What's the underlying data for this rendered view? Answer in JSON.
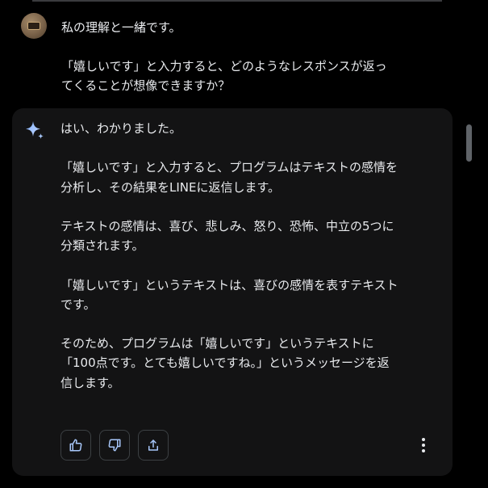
{
  "user_message": {
    "avatar_icon": "user-avatar-icon",
    "text": "私の理解と一緒です。\n\n「嬉しいです」と入力すると、どのようなレスポンスが返っ\nてくることが想像できますか？"
  },
  "assistant_message": {
    "icon": "sparkle-icon",
    "text": "はい、わかりました。\n\n「嬉しいです」と入力すると、プログラムはテキストの感情を\n分析し、その結果をLINEに返信します。\n\nテキストの感情は、喜び、悲しみ、怒り、恐怖、中立の5つに\n分類されます。\n\n「嬉しいです」というテキストは、喜びの感情を表すテキスト\nです。\n\nそのため、プログラムは「嬉しいです」というテキストに\n「100点です。とても嬉しいですね。」というメッセージを返\n信します。"
  },
  "actions": {
    "thumbs_up_icon": "thumbs-up-icon",
    "thumbs_down_icon": "thumbs-down-icon",
    "share_icon": "share-icon",
    "more_icon": "more-vertical-icon"
  },
  "colors": {
    "background": "#000000",
    "card": "#131314",
    "text": "#e8eaed",
    "icon_accent": "#a8c7fa",
    "border": "#3c4043"
  }
}
